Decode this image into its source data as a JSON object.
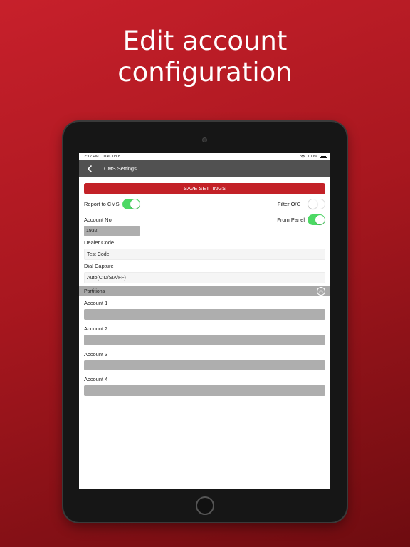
{
  "headline": {
    "line1": "Edit account",
    "line2": "configuration"
  },
  "status_bar": {
    "time": "12:12 PM",
    "date": "Tue Jun 8",
    "dots": "....",
    "battery": "100%"
  },
  "nav": {
    "title": "CMS Settings",
    "back_icon": "chevron-left-icon"
  },
  "save_button": {
    "label": "SAVE SETTINGS"
  },
  "report_to_cms": {
    "label": "Report to CMS",
    "on": true
  },
  "filter_oc": {
    "label": "Filter O/C",
    "on": false
  },
  "account_no": {
    "label": "Account No",
    "value": "1932"
  },
  "from_panel": {
    "label": "From Panel",
    "on": true
  },
  "dealer_code": {
    "label": "Dealer Code",
    "value": "Test Code"
  },
  "dial_capture": {
    "label": "Dial Capture",
    "value": "Auto(CID/SIA/FF)"
  },
  "partitions": {
    "title": "Partitions",
    "collapse_icon": "chevron-up-circle-icon",
    "accounts": [
      {
        "label": "Account 1",
        "value": ""
      },
      {
        "label": "Account 2",
        "value": ""
      },
      {
        "label": "Account 3",
        "value": ""
      },
      {
        "label": "Account 4",
        "value": ""
      }
    ]
  },
  "colors": {
    "brand_red": "#c32127",
    "nav_gray": "#515151",
    "toggle_on": "#4cd964",
    "field_gray": "#aeaeae"
  }
}
